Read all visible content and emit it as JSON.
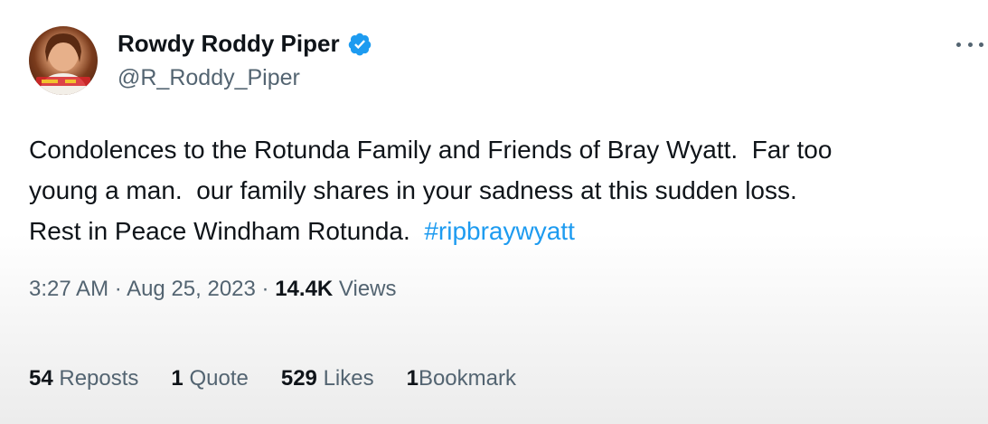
{
  "author": {
    "display_name": "Rowdy Roddy Piper",
    "handle": "@R_Roddy_Piper",
    "verified": true,
    "avatar_icon": "profile-photo"
  },
  "tweet": {
    "lines": [
      "Condolences to the Rotunda Family and Friends of Bray Wyatt.  Far too",
      "young a man.  our family shares in your sadness at this sudden loss.",
      "Rest in Peace Windham Rotunda.  "
    ],
    "hashtag": "#ripbraywyatt"
  },
  "meta": {
    "time": "3:27 AM",
    "separator": " · ",
    "date": "Aug 25, 2023",
    "views_count": "14.4K",
    "views_label": "Views"
  },
  "stats": {
    "reposts_count": "54",
    "reposts_label": "Reposts",
    "quotes_count": "1",
    "quotes_label": "Quote",
    "likes_count": "529",
    "likes_label": "Likes",
    "bookmarks_count": "1",
    "bookmarks_label": "Bookmark"
  },
  "colors": {
    "text": "#0f1419",
    "secondary": "#536471",
    "link": "#1d9bf0",
    "verified": "#1d9bf0"
  }
}
